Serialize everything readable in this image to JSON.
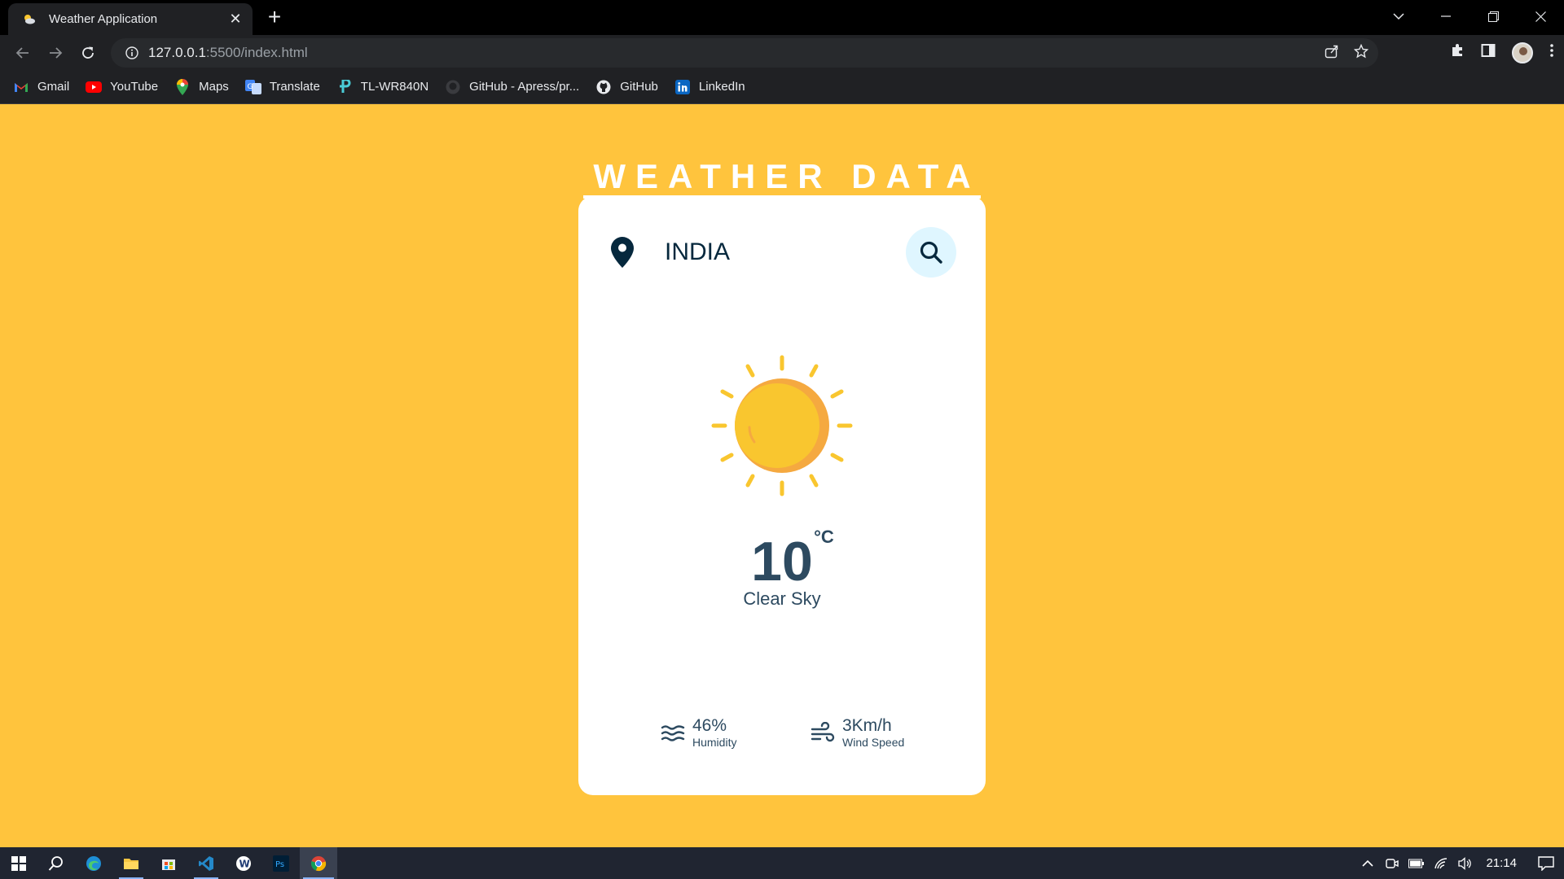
{
  "browser": {
    "tab_title": "Weather Application",
    "tab_close": "✕",
    "new_tab": "+",
    "url_host": "127.0.0.1",
    "url_rest": ":5500/index.html",
    "bookmarks": [
      {
        "label": "Gmail",
        "icon": "gmail-icon"
      },
      {
        "label": "YouTube",
        "icon": "youtube-icon"
      },
      {
        "label": "Maps",
        "icon": "maps-icon"
      },
      {
        "label": "Translate",
        "icon": "translate-icon"
      },
      {
        "label": "TL-WR840N",
        "icon": "tplink-icon"
      },
      {
        "label": "GitHub - Apress/pr...",
        "icon": "github-icon"
      },
      {
        "label": "GitHub",
        "icon": "github-icon"
      },
      {
        "label": "LinkedIn",
        "icon": "linkedin-icon"
      }
    ]
  },
  "page": {
    "heading": "WEATHER DATA",
    "city": "INDIA",
    "weather_icon": "sun-icon",
    "temperature": "10",
    "temperature_unit": "°C",
    "description": "Clear Sky",
    "humidity": {
      "value": "46%",
      "label": "Humidity"
    },
    "wind": {
      "value": "3Km/h",
      "label": "Wind Speed"
    }
  },
  "taskbar": {
    "clock": "21:14"
  },
  "colors": {
    "background": "#ffc43d",
    "card": "#ffffff",
    "text_dark": "#06283d",
    "search_button_bg": "#dff6ff",
    "sun": "#f9c62f",
    "sun_shadow": "#f5a940"
  }
}
